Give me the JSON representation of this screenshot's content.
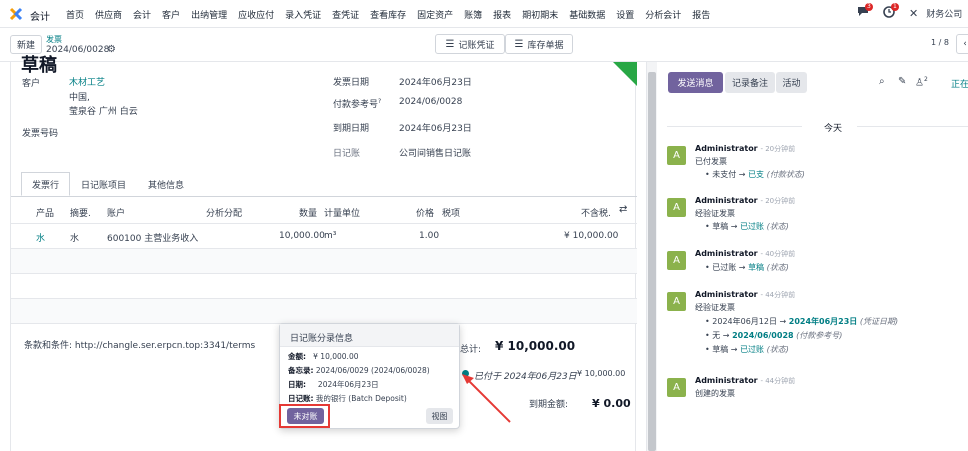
{
  "topnav": {
    "app": "会计",
    "menu": [
      "首页",
      "供应商",
      "会计",
      "客户",
      "出纳管理",
      "应收应付",
      "录入凭证",
      "查凭证",
      "查看库存",
      "固定资产",
      "账簿",
      "报表",
      "期初期末",
      "基础数据",
      "设置",
      "分析会计",
      "报告"
    ],
    "chat_badge": "3",
    "activity_badge": "1",
    "company": "财务公司"
  },
  "control": {
    "new_label": "新建",
    "breadcrumb": "发票",
    "record": "2024/06/0028",
    "btn_voucher": "记账凭证",
    "btn_stock": "库存单据",
    "pager": "1 / 8"
  },
  "form": {
    "title_partial": "草稿",
    "customer_label": "客户",
    "customer_name": "木材工艺",
    "customer_addr1": "中国,",
    "customer_addr2": "莹泉谷 广州 白云",
    "invoice_no_label": "发票号码",
    "invoice_date_label": "发票日期",
    "invoice_date": "2024年06月23日",
    "payment_ref_label": "付款参考号",
    "payment_ref_sup": "?",
    "payment_ref": "2024/06/0028",
    "due_date_label": "到期日期",
    "due_date": "2024年06月23日",
    "journal_label": "日记账",
    "journal": "公司间销售日记账",
    "tabs": [
      "发票行",
      "日记账项目",
      "其他信息"
    ],
    "columns": [
      "产品",
      "摘要.",
      "账户",
      "分析分配",
      "数量",
      "计量单位",
      "价格",
      "税项",
      "不含税."
    ],
    "lines": [
      {
        "product": "水",
        "desc": "水",
        "account": "600100 主营业务收入",
        "qty": "10,000.00",
        "uom": "m³",
        "price": "1.00",
        "subtotal": "¥ 10,000.00"
      }
    ],
    "terms": "条款和条件: http://changle.ser.erpcn.top:3341/terms",
    "total_label": "总计:",
    "total": "¥ 10,000.00",
    "paid_text": "已付于 2024年06月23日",
    "paid_amount": "¥ 10,000.00",
    "due_label": "到期金额:",
    "due_amount": "¥ 0.00"
  },
  "popover": {
    "title": "日记账分录信息",
    "amount_label": "金额:",
    "amount": "¥ 10,000.00",
    "memo_label": "备忘录:",
    "memo": "2024/06/0029 (2024/06/0028)",
    "date_label": "日期:",
    "date": "2024年06月23日",
    "journal_label": "日记账:",
    "journal": "我的银行 (Batch Deposit)",
    "unreconcile": "未对账",
    "view": "视图"
  },
  "chatter": {
    "send_message": "发送消息",
    "log_note": "记录备注",
    "activity": "活动",
    "followers": "2",
    "following": "正在",
    "today": "今天",
    "messages": [
      {
        "author": "Administrator",
        "time": "- 20分钟前",
        "body": "已付发票",
        "changes": [
          {
            "from": "未支付",
            "to": "已支",
            "field": "(付款状态)"
          }
        ]
      },
      {
        "author": "Administrator",
        "time": "- 20分钟前",
        "body": "经验证发票",
        "changes": [
          {
            "from": "草稿",
            "to": "已过账",
            "field": "(状态)"
          }
        ]
      },
      {
        "author": "Administrator",
        "time": "- 40分钟前",
        "body": "",
        "changes": [
          {
            "from": "已过账",
            "to": "草稿",
            "field": "(状态)"
          }
        ]
      },
      {
        "author": "Administrator",
        "time": "- 44分钟前",
        "body": "经验证发票",
        "changes": [
          {
            "from": "2024年06月12日",
            "to": "2024年06月23日",
            "field": "(凭证日期)"
          },
          {
            "from": "无",
            "to": "2024/06/0028",
            "field": "(付款参考号)"
          },
          {
            "from": "草稿",
            "to": "已过账",
            "field": "(状态)"
          }
        ]
      },
      {
        "author": "Administrator",
        "time": "- 44分钟前",
        "body": "创建的发票",
        "changes": []
      }
    ],
    "avatar_letter": "A"
  },
  "colors": {
    "accent": "#71639e",
    "link": "#017e84",
    "avatar": "#8bb24c",
    "annotation": "#e53935"
  }
}
